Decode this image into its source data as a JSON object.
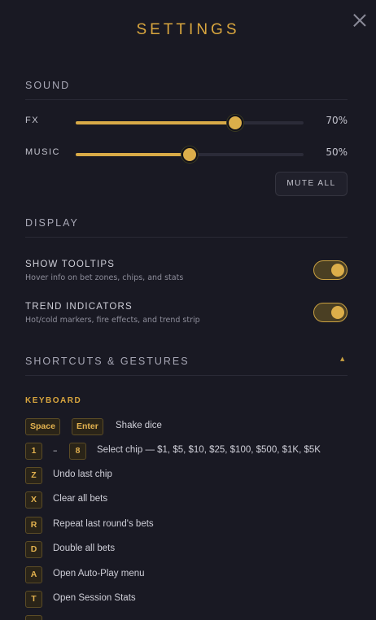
{
  "header": {
    "title": "SETTINGS"
  },
  "sound": {
    "heading": "SOUND",
    "fx": {
      "label": "FX",
      "value": 70,
      "value_text": "70%"
    },
    "music": {
      "label": "MUSIC",
      "value": 50,
      "value_text": "50%"
    },
    "mute_label": "MUTE ALL"
  },
  "display": {
    "heading": "DISPLAY",
    "tooltips": {
      "title": "SHOW TOOLTIPS",
      "desc": "Hover info on bet zones, chips, and stats",
      "on": true
    },
    "trends": {
      "title": "TREND INDICATORS",
      "desc": "Hot/cold markers, fire effects, and trend strip",
      "on": true
    }
  },
  "shortcuts": {
    "heading": "SHORTCUTS & GESTURES",
    "keyboard_heading": "KEYBOARD",
    "items": [
      {
        "keys": [
          "Space",
          "Enter"
        ],
        "sep": "",
        "text": "Shake dice"
      },
      {
        "keys": [
          "1",
          "8"
        ],
        "sep": "–",
        "text": "Select chip — $1, $5, $10, $25, $100, $500, $1K, $5K"
      },
      {
        "keys": [
          "Z"
        ],
        "sep": "",
        "text": "Undo last chip"
      },
      {
        "keys": [
          "X"
        ],
        "sep": "",
        "text": "Clear all bets"
      },
      {
        "keys": [
          "R"
        ],
        "sep": "",
        "text": "Repeat last round's bets"
      },
      {
        "keys": [
          "D"
        ],
        "sep": "",
        "text": "Double all bets"
      },
      {
        "keys": [
          "A"
        ],
        "sep": "",
        "text": "Open Auto-Play menu"
      },
      {
        "keys": [
          "T"
        ],
        "sep": "",
        "text": "Open Session Stats"
      }
    ]
  },
  "colors": {
    "accent": "#d9a63e",
    "panel": "#191923"
  },
  "icons": {
    "close": "close-icon",
    "collapse": "caret-up-icon"
  }
}
